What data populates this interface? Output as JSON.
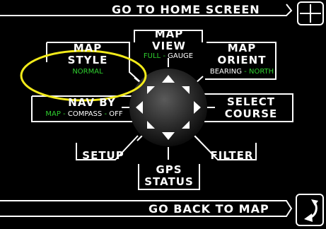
{
  "top_bar": {
    "label": "GO TO HOME SCREEN"
  },
  "bottom_bar": {
    "label": "GO BACK TO MAP"
  },
  "menu": {
    "map_view": {
      "title_line1": "MAP",
      "title_line2": "VIEW",
      "opt1": "FULL",
      "opt2": "GAUGE"
    },
    "map_style": {
      "title_line1": "MAP",
      "title_line2": "STYLE",
      "value": "NORMAL"
    },
    "map_orient": {
      "title_line1": "MAP",
      "title_line2": "ORIENT",
      "opt1": "BEARING",
      "opt2": "NORTH"
    },
    "nav_by": {
      "title": "NAV BY",
      "opt1": "MAP",
      "opt2": "COMPASS",
      "opt3": "OFF"
    },
    "select_course": {
      "title_line1": "SELECT",
      "title_line2": "COURSE"
    },
    "setup": {
      "title": "SETUP"
    },
    "filter": {
      "title": "FILTER"
    },
    "gps_status": {
      "title_line1": "GPS",
      "title_line2": "STATUS"
    },
    "separator": "-"
  },
  "colors": {
    "accent_green": "#2fd02f",
    "highlight_yellow": "#f2ea1a",
    "background": "#000000",
    "foreground": "#ffffff"
  },
  "icons": {
    "home": "home-grid-icon",
    "back": "back-arrow-icon",
    "dpad": "dpad-icon"
  }
}
